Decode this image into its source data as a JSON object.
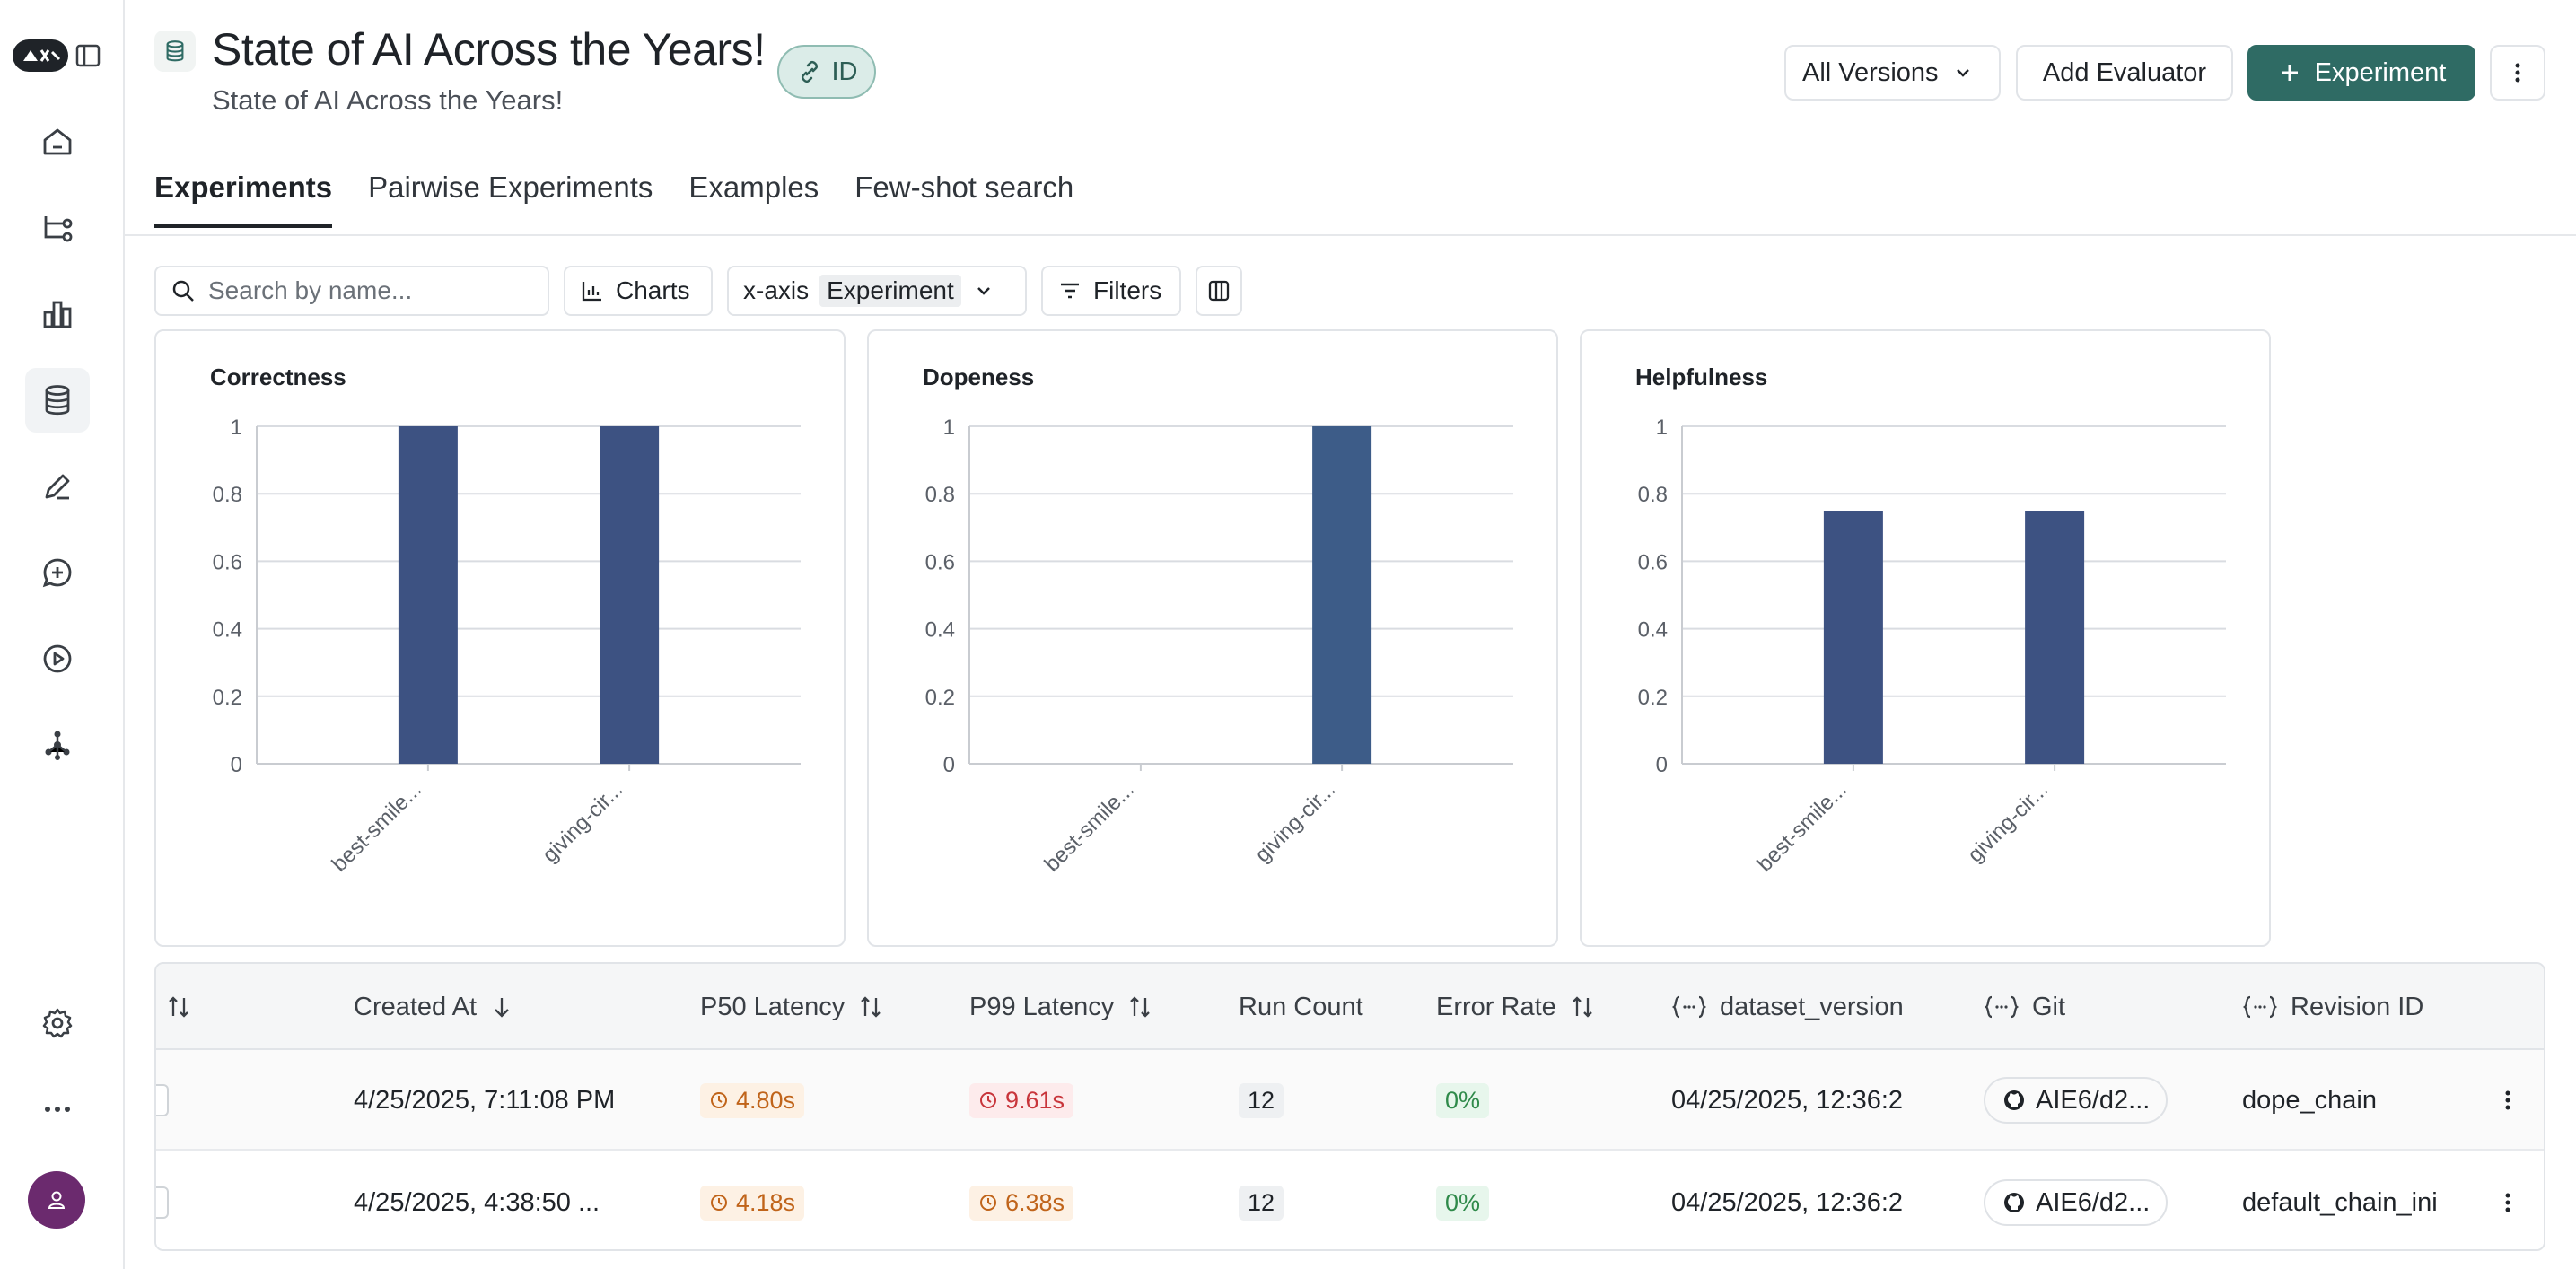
{
  "sidebar": {
    "logo_text": "✦",
    "items": [
      {
        "name": "home-icon"
      },
      {
        "name": "tracing-projects-icon"
      },
      {
        "name": "monitoring-icon"
      },
      {
        "name": "datasets-icon",
        "active": true
      },
      {
        "name": "annotation-queues-icon"
      },
      {
        "name": "prompts-icon"
      },
      {
        "name": "playground-icon"
      },
      {
        "name": "deployments-icon"
      }
    ],
    "bottom": [
      {
        "name": "settings-icon"
      },
      {
        "name": "more-icon"
      },
      {
        "name": "user-avatar"
      }
    ]
  },
  "header": {
    "title": "State of AI Across the Years!",
    "subtitle": "State of AI Across the Years!",
    "id_label": "ID",
    "versions_label": "All Versions",
    "add_evaluator_label": "Add Evaluator",
    "experiment_label": "Experiment"
  },
  "tabs": [
    {
      "label": "Experiments",
      "active": true
    },
    {
      "label": "Pairwise Experiments"
    },
    {
      "label": "Examples"
    },
    {
      "label": "Few-shot search"
    }
  ],
  "toolbar": {
    "search_placeholder": "Search by name...",
    "charts_label": "Charts",
    "xaxis_label": "x-axis",
    "xaxis_value": "Experiment",
    "filters_label": "Filters"
  },
  "chart_data": [
    {
      "type": "bar",
      "title": "Correctness",
      "categories": [
        "best-smile...",
        "giving-cir..."
      ],
      "values": [
        1,
        1
      ],
      "ylim": [
        0,
        1
      ],
      "yticks": [
        "0",
        "0.2",
        "0.4",
        "0.6",
        "0.8",
        "1"
      ],
      "color": "#3d5282"
    },
    {
      "type": "bar",
      "title": "Dopeness",
      "categories": [
        "best-smile...",
        "giving-cir..."
      ],
      "values": [
        0,
        1
      ],
      "ylim": [
        0,
        1
      ],
      "yticks": [
        "0",
        "0.2",
        "0.4",
        "0.6",
        "0.8",
        "1"
      ],
      "color": "#3d5c88"
    },
    {
      "type": "bar",
      "title": "Helpfulness",
      "categories": [
        "best-smile...",
        "giving-cir..."
      ],
      "values": [
        0.75,
        0.75
      ],
      "ylim": [
        0,
        1
      ],
      "yticks": [
        "0",
        "0.2",
        "0.4",
        "0.6",
        "0.8",
        "1"
      ],
      "color": "#3d5282"
    }
  ],
  "table": {
    "headers": {
      "created_at": "Created At",
      "p50": "P50 Latency",
      "p99": "P99 Latency",
      "run_count": "Run Count",
      "error_rate": "Error Rate",
      "dataset_version": "dataset_version",
      "git": "Git",
      "revision_id": "Revision ID"
    },
    "rows": [
      {
        "created_at": "4/25/2025, 7:11:08 PM",
        "p50": "4.80s",
        "p99": "9.61s",
        "run_count": "12",
        "error_rate": "0%",
        "dataset_version": "04/25/2025, 12:36:2",
        "git": "AIE6/d2...",
        "revision_id": "dope_chain"
      },
      {
        "created_at": "4/25/2025, 4:38:50 ...",
        "p50": "4.18s",
        "p99": "6.38s",
        "run_count": "12",
        "error_rate": "0%",
        "dataset_version": "04/25/2025, 12:36:2",
        "git": "AIE6/d2...",
        "revision_id": "default_chain_ini"
      }
    ]
  }
}
